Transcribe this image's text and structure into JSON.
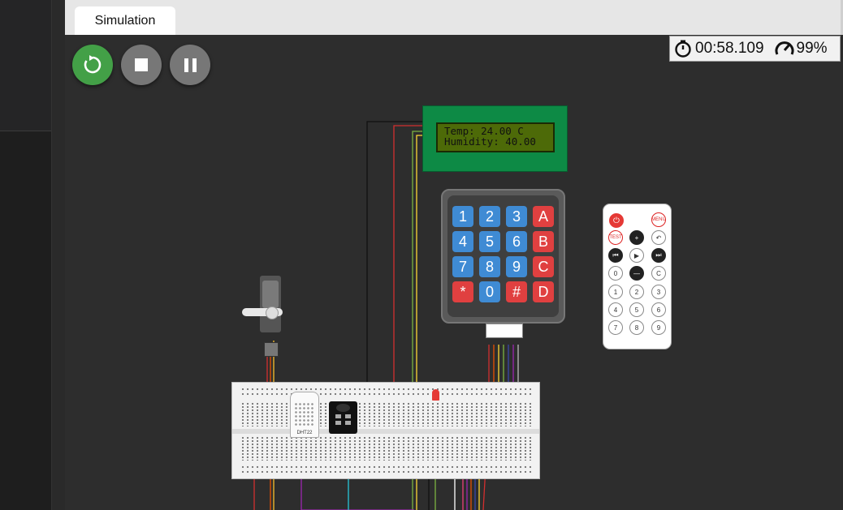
{
  "tabs": [
    {
      "label": "Simulation"
    }
  ],
  "controls": {
    "restart": {
      "icon": "restart-icon",
      "color": "#43a047"
    },
    "stop": {
      "icon": "stop-icon",
      "color": "#777777"
    },
    "pause": {
      "icon": "pause-icon",
      "color": "#777777"
    }
  },
  "status": {
    "time": "00:58.109",
    "speed": "99%",
    "timer_icon": "stopwatch-icon",
    "speed_icon": "speedometer-icon"
  },
  "lcd": {
    "line1": "Temp: 24.00 C",
    "line2": "Humidity: 40.00"
  },
  "keypad": {
    "keys": [
      [
        "1",
        "2",
        "3",
        "A"
      ],
      [
        "4",
        "5",
        "6",
        "B"
      ],
      [
        "7",
        "8",
        "9",
        "C"
      ],
      [
        "*",
        "0",
        "#",
        "D"
      ]
    ]
  },
  "remote": {
    "buttons": [
      "MENU",
      "TEST",
      "+",
      "↶",
      "⏮",
      "▶",
      "⏭",
      "0",
      "—",
      "C",
      "1",
      "2",
      "3",
      "4",
      "5",
      "6",
      "7",
      "8",
      "9"
    ]
  },
  "dht": {
    "label": "DHT22"
  }
}
